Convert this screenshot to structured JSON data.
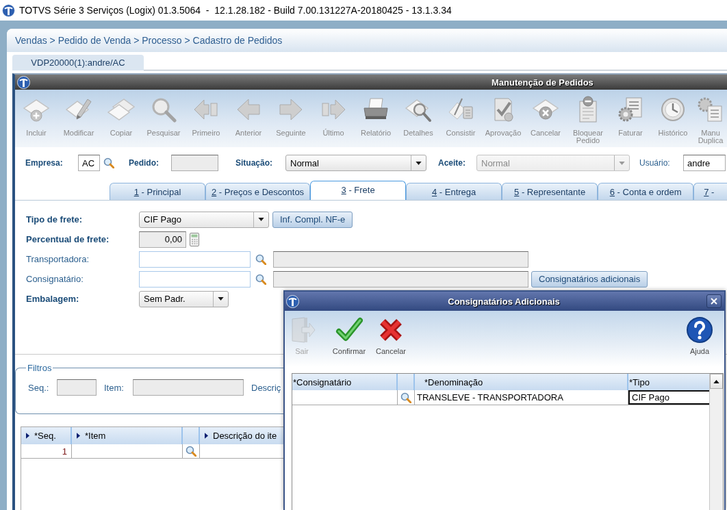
{
  "app_title": "TOTVS Série 3 Serviços (Logix) 01.3.5064  -  12.1.28.182 - Build 7.00.131227A-20180425 - 13.1.3.34",
  "breadcrumb": "Vendas > Pedido de Venda > Processo > Cadastro de Pedidos",
  "session_tabs": [
    {
      "label": "VDP20000(1):andre/AC",
      "selected": true
    }
  ],
  "window": {
    "title": "Manutenção de Pedidos",
    "toolbar": [
      {
        "label": "Incluir",
        "kind": "add"
      },
      {
        "label": "Modificar",
        "kind": "edit"
      },
      {
        "label": "Copiar",
        "kind": "copy"
      },
      {
        "label": "Pesquisar",
        "kind": "search"
      },
      {
        "label": "Primeiro",
        "kind": "first"
      },
      {
        "label": "Anterior",
        "kind": "previous"
      },
      {
        "label": "Seguinte",
        "kind": "next"
      },
      {
        "label": "Último",
        "kind": "last"
      },
      {
        "label": "Relatório",
        "kind": "print"
      },
      {
        "label": "Detalhes",
        "kind": "details"
      },
      {
        "label": "Consistir",
        "kind": "validate"
      },
      {
        "label": "Aprovação",
        "kind": "approve"
      },
      {
        "label": "Cancelar",
        "kind": "cancel"
      },
      {
        "label": "Bloquear Pedido",
        "kind": "block"
      },
      {
        "label": "Faturar",
        "kind": "invoice"
      },
      {
        "label": "Histórico",
        "kind": "history"
      },
      {
        "label": "Manu Duplica",
        "kind": "duplicate"
      }
    ],
    "header_fields": [
      {
        "label": "Empresa:",
        "required": true,
        "kind": "lookup",
        "value": "AC",
        "disabled": false
      },
      {
        "label": "Pedido:",
        "required": true,
        "kind": "text",
        "disabled": true
      },
      {
        "label": "Situação:",
        "required": true,
        "kind": "select",
        "value": "Normal",
        "disabled": false
      },
      {
        "label": "Aceite:",
        "required": true,
        "kind": "select",
        "value": "Normal",
        "disabled": true
      },
      {
        "label": "Usuário:",
        "required": false,
        "kind": "text",
        "value": "andre",
        "disabled": false
      }
    ],
    "tabs": [
      {
        "label": "1 - Principal",
        "selected": false
      },
      {
        "label": "2 - Preços e Descontos",
        "selected": false
      },
      {
        "label": "3 - Frete",
        "selected": true
      },
      {
        "label": "4 - Entrega",
        "selected": false
      },
      {
        "label": "5 - Representante",
        "selected": false
      },
      {
        "label": "6 - Conta e ordem",
        "selected": false
      },
      {
        "label": "7 -",
        "selected": false
      }
    ],
    "freight": [
      {
        "label": "Tipo de frete:",
        "required": true,
        "kind": "select",
        "value": "CIF Pago",
        "disabled": false,
        "button": "Inf. Compl. NF-e"
      },
      {
        "label": "Percentual de frete:",
        "required": true,
        "kind": "number",
        "value": "0,00",
        "disabled": true
      },
      {
        "label": "Transportadora:",
        "required": false,
        "kind": "lookup",
        "disabled": false
      },
      {
        "label": "Consignatário:",
        "required": false,
        "kind": "lookup",
        "disabled": false,
        "button": "Consignatários adicionais"
      },
      {
        "label": "Embalagem:",
        "required": true,
        "kind": "select",
        "value": "Sem Padr.",
        "disabled": false
      }
    ],
    "filters": {
      "title": "Filtros",
      "fields": [
        {
          "label": "Seq.:",
          "kind": "text"
        },
        {
          "label": "Item:",
          "kind": "text"
        },
        {
          "label": "Descriç",
          "kind": "caption"
        }
      ]
    },
    "items_grid": {
      "columns": [
        {
          "label": "*Seq.",
          "kind": "text"
        },
        {
          "label": "*Item",
          "kind": "text"
        },
        {
          "kind": "lookup"
        },
        {
          "label": "Descrição do ite",
          "kind": "text"
        }
      ],
      "rows": [
        {
          "seq": "1"
        }
      ]
    }
  },
  "dialog": {
    "title": "Consignatários Adicionais",
    "toolbar": [
      {
        "label": "Sair",
        "kind": "exit",
        "disabled": true
      },
      {
        "label": "Confirmar",
        "kind": "confirm",
        "disabled": false
      },
      {
        "label": "Cancelar",
        "kind": "cancel",
        "disabled": false
      },
      {
        "label": "Ajuda",
        "kind": "help",
        "disabled": false
      }
    ],
    "grid": {
      "columns": [
        {
          "label": "*Consignatário",
          "kind": "text"
        },
        {
          "kind": "lookup"
        },
        {
          "label": "*Denominação",
          "kind": "text"
        },
        {
          "label": "*Tipo",
          "kind": "text"
        }
      ],
      "rows": [
        {
          "denomination": "TRANSLEVE - TRANSPORTADORA",
          "type": "CIF Pago",
          "type_focused": true
        }
      ]
    }
  }
}
